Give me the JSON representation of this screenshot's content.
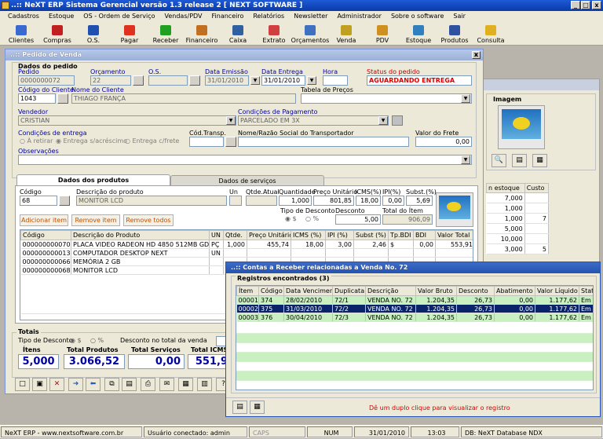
{
  "app": {
    "title": "..:: NeXT ERP Sistema Gerencial  versão 1.3 release 2  [ NEXT SOFTWARE ]",
    "min": "_",
    "max": "□",
    "close": "x"
  },
  "menu": [
    "Cadastros",
    "Estoque",
    "OS - Ordem de Serviço",
    "Vendas/PDV",
    "Financeiro",
    "Relatórios",
    "Newsletter",
    "Administrador",
    "Sobre o software",
    "Sair"
  ],
  "toolbar": [
    {
      "label": "Clientes",
      "icon": "clients-icon",
      "color": "#3a6ad0"
    },
    {
      "label": "Compras",
      "icon": "cart-icon",
      "color": "#c02020"
    },
    {
      "label": "O.S.",
      "icon": "wrench-icon",
      "color": "#2050b0"
    },
    {
      "label": "Pagar",
      "icon": "minus-circle-icon",
      "color": "#e03020"
    },
    {
      "label": "Receber",
      "icon": "plus-circle-icon",
      "color": "#20a020"
    },
    {
      "label": "Financeiro",
      "icon": "chart-icon",
      "color": "#c07020"
    },
    {
      "label": "Caixa",
      "icon": "calculator-icon",
      "color": "#3060a0"
    },
    {
      "label": "Extrato",
      "icon": "extract-icon",
      "color": "#d04040"
    },
    {
      "label": "Orçamentos",
      "icon": "quote-icon",
      "color": "#4070c0"
    },
    {
      "label": "Venda",
      "icon": "sale-icon",
      "color": "#c0a020"
    },
    {
      "label": "PDV",
      "icon": "pdv-icon",
      "color": "#d09020"
    },
    {
      "label": "Estoque",
      "icon": "stock-icon",
      "color": "#3080c0"
    },
    {
      "label": "Produtos",
      "icon": "products-icon",
      "color": "#3050a0"
    },
    {
      "label": "Consulta",
      "icon": "folder-search-icon",
      "color": "#e0b020"
    }
  ],
  "pedido": {
    "title": "..:: Pedido de Venda",
    "section": "Dados do pedido",
    "labels": {
      "pedido": "Pedido",
      "orcamento": "Orçamento",
      "os": "O.S.",
      "emissao": "Data Emissão",
      "entrega": "Data Entrega",
      "hora": "Hora",
      "status": "Status do pedido",
      "cod_cliente": "Código do Cliente",
      "nome_cliente": "Nome do Cliente",
      "tabela": "Tabela de Preços",
      "vendedor": "Vendedor",
      "condicoes": "Condições de Pagamento",
      "cond_entrega": "Condições de entrega",
      "cod_transp": "Cód.Transp.",
      "transportador": "Nome/Razão Social do Transportador",
      "valor_frete": "Valor do Frete",
      "observacoes": "Observações"
    },
    "values": {
      "pedido": "0000000072",
      "orcamento": "22",
      "os": "",
      "emissao": "31/01/2010",
      "entrega": "31/01/2010",
      "hora": "",
      "status": "AGUARDANDO ENTREGA",
      "cod_cliente": "1043",
      "nome_cliente": "THIAGO FRANÇA",
      "tabela": "",
      "vendedor": "CRISTIAN",
      "condicoes": "PARCELADO EM 3X",
      "cod_transp": "",
      "transportador": "",
      "valor_frete": "0,00",
      "observacoes": ""
    },
    "entrega_opts": [
      "À retirar",
      "Entrega s/acréscimo",
      "Entrega c/frete"
    ],
    "tabs": [
      "Dados dos produtos",
      "Dados de serviços"
    ],
    "prod_labels": {
      "codigo": "Código",
      "descricao": "Descrição do produto",
      "un": "Un",
      "qtde": "Qtde.Atual",
      "quantidade": "Quantidade",
      "preco": "Preço Unitário",
      "icms": "ICMS(%)",
      "ipi": "IPI(%)",
      "subst": "Subst.(%)",
      "tipo_desc": "Tipo de Desconto",
      "desconto": "Desconto",
      "total_item": "Total do Ítem"
    },
    "prod_values": {
      "codigo": "68",
      "descricao": "MONITOR LCD",
      "un": "",
      "qtde": "",
      "quantidade": "1,000",
      "preco": "801,85",
      "icms": "18,00",
      "ipi": "0,00",
      "subst": "5,69",
      "desconto": "5,00",
      "total_item": "906,09"
    },
    "desc_opts": [
      "$",
      "%"
    ],
    "actions": [
      "Adicionar item",
      "Remove item",
      "Remove todos"
    ],
    "grid_headers": [
      "Código",
      "Descrição do Produto",
      "UN",
      "Qtde.",
      "Preço Unitário",
      "ICMS (%)",
      "IPI (%)",
      "Subst (%)",
      "Tp.BDI",
      "BDI",
      "Valor Total"
    ],
    "grid_rows": [
      [
        "000000000070",
        "PLACA VIDEO RADEON HD 4850 512MB GD...",
        "PÇ",
        "1,000",
        "455,74",
        "18,00",
        "3,00",
        "2,46",
        "$",
        "0,00",
        "553,91"
      ],
      [
        "000000000013",
        "COMPUTADOR DESKTOP NEXT",
        "UN",
        "",
        "",
        "",
        "",
        "",
        "",
        "",
        ""
      ],
      [
        "000000000066",
        "MEMÓRIA 2 GB",
        "",
        "",
        "",
        "",
        "",
        "",
        "",
        "",
        ""
      ],
      [
        "000000000068",
        "MONITOR LCD",
        "",
        "",
        "",
        "",
        "",
        "",
        "",
        "",
        ""
      ]
    ],
    "totais": {
      "title": "Totais",
      "tipo_desc": "Tipo de Desconto",
      "desc_total": "Desconto no total da venda",
      "itens_label": "Ítens",
      "itens": "5,000",
      "produtos_label": "Total Produtos",
      "produtos": "3.066,52",
      "servicos_label": "Total Serviços",
      "servicos": "0,00",
      "icms_label": "Total ICMS",
      "icms": "551,9"
    }
  },
  "side": {
    "imagem": "Imagem",
    "headers": [
      "n estoque",
      "Custo"
    ],
    "rows": [
      [
        "7,000",
        ""
      ],
      [
        "1,000",
        ""
      ],
      [
        "1,000",
        "7"
      ],
      [
        "5,000",
        ""
      ],
      [
        "10,000",
        ""
      ],
      [
        "3,000",
        "5"
      ]
    ]
  },
  "receber": {
    "title": "..:: Contas a Receber relacionadas a Venda No. 72",
    "registros": "Registros encontrados (3)",
    "headers": [
      "Ítem",
      "Código",
      "Data Vencimento",
      "Duplicata",
      "Descrição",
      "Valor Bruto",
      "Desconto",
      "Abatimento",
      "Valor Líquido",
      "Stat"
    ],
    "rows": [
      [
        "00001",
        "374",
        "28/02/2010",
        "72/1",
        "VENDA NO. 72",
        "1.204,35",
        "26,73",
        "0,00",
        "1.177,62",
        "Em A"
      ],
      [
        "00002",
        "375",
        "31/03/2010",
        "72/2",
        "VENDA NO. 72",
        "1.204,35",
        "26,73",
        "0,00",
        "1.177,62",
        "Em A"
      ],
      [
        "00003",
        "376",
        "30/04/2010",
        "72/3",
        "VENDA NO. 72",
        "1.204,35",
        "26,73",
        "0,00",
        "1.177,62",
        "Em A"
      ]
    ],
    "hint": "Dê um duplo clique para visualizar o registro"
  },
  "status": {
    "site": "NeXT ERP - www.nextsoftware.com.br",
    "user": "Usuário conectado: admin",
    "caps": "CAPS",
    "num": "NUM",
    "date": "31/01/2010",
    "time": "13:03",
    "db": "DB: NeXT Database NDX"
  }
}
